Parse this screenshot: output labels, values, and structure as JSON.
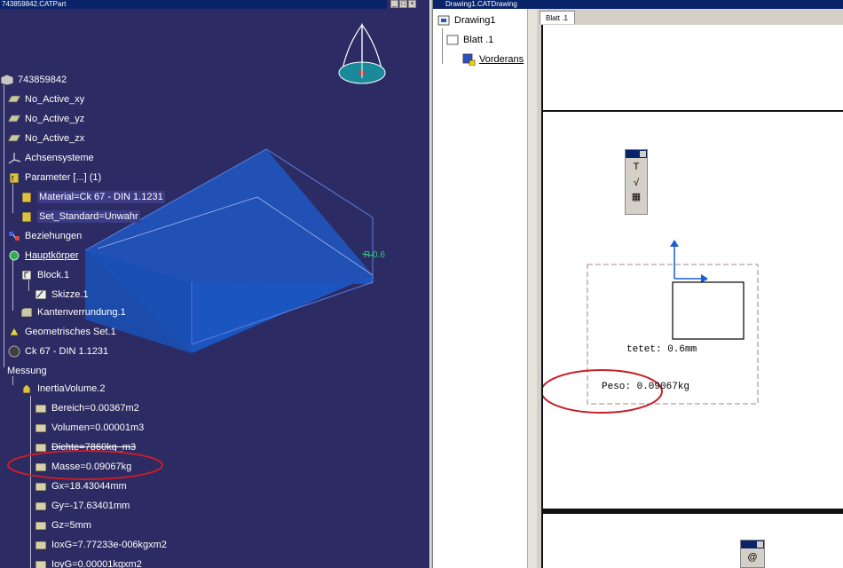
{
  "part_window": {
    "title": "743859842.CATPart",
    "tree": [
      {
        "label": "743859842"
      },
      {
        "label": "No_Active_xy"
      },
      {
        "label": "No_Active_yz"
      },
      {
        "label": "No_Active_zx"
      },
      {
        "label": "Achsensysteme"
      },
      {
        "label": "Parameter [...] (1)"
      },
      {
        "label": "Material=Ck 67 - DIN 1.1231"
      },
      {
        "label": "Set_Standard=Unwahr"
      },
      {
        "label": "Beziehungen"
      },
      {
        "label": "Hauptkörper"
      },
      {
        "label": "Block.1"
      },
      {
        "label": "Skizze.1"
      },
      {
        "label": "Kantenverrundung.1"
      },
      {
        "label": "Geometrisches Set.1"
      },
      {
        "label": "Ck 67 - DIN 1.1231"
      },
      {
        "label": "Messung"
      },
      {
        "label": "InertiaVolume.2"
      },
      {
        "label": "Bereich=0.00367m2"
      },
      {
        "label": "Volumen=0.00001m3"
      },
      {
        "label": "Dichte=7860kg_m3"
      },
      {
        "label": "Masse=0.09067kg"
      },
      {
        "label": "Gx=18.43044mm"
      },
      {
        "label": "Gy=-17.63401mm"
      },
      {
        "label": "Gz=5mm"
      },
      {
        "label": "IoxG=7.77233e-006kgxm2"
      },
      {
        "label": "IoyG=0.00001kgxm2"
      }
    ],
    "fillet_label": "R 0.6"
  },
  "drawing_window": {
    "title": "Drawing1.CATDrawing",
    "tree": [
      {
        "label": "Drawing1"
      },
      {
        "label": "Blatt .1"
      },
      {
        "label": "Vorderans"
      }
    ],
    "tab": "Blatt .1",
    "text_tetet": "tetet: 0.6mm",
    "text_peso": "Peso: 0.09067kg"
  },
  "colors": {
    "viewport_bg": "#2c2b63",
    "part_fill": "#1f5fd0",
    "highlight_ellipse": "#c81e28"
  }
}
